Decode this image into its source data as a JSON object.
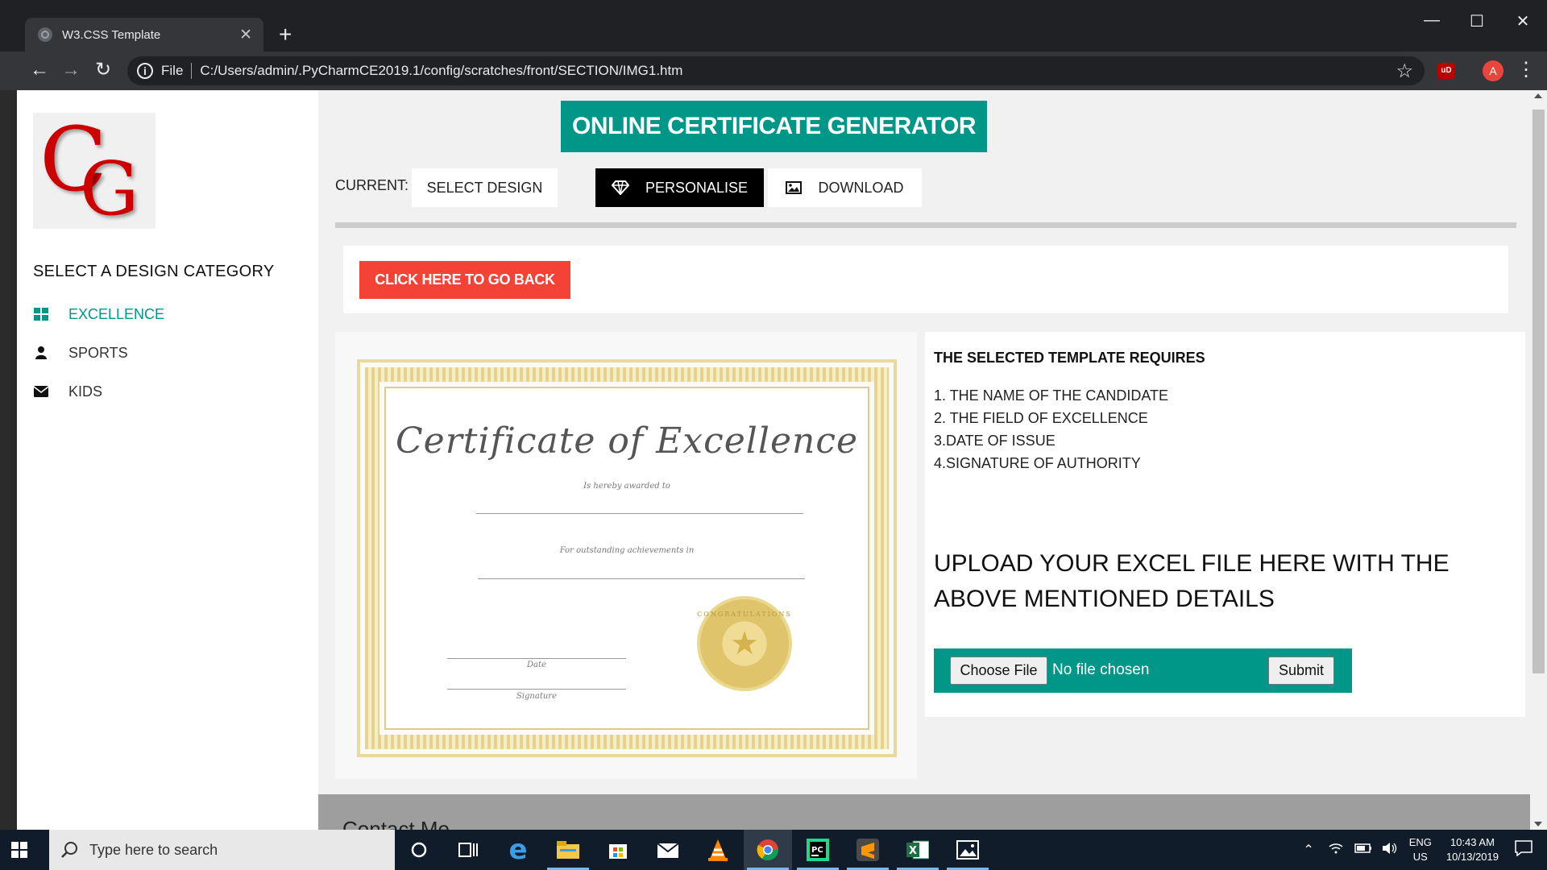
{
  "browser": {
    "tab_title": "W3.CSS Template",
    "scheme_label": "File",
    "url": "C:/Users/admin/.PyCharmCE2019.1/config/scratches/front/SECTION/IMG1.htm",
    "profile_initial": "A",
    "ext_label": "uD"
  },
  "sidebar": {
    "title": "SELECT A DESIGN CATEGORY",
    "items": [
      {
        "label": "EXCELLENCE",
        "icon": "grid-icon"
      },
      {
        "label": "SPORTS",
        "icon": "user-icon"
      },
      {
        "label": "KIDS",
        "icon": "envelope-icon"
      }
    ],
    "logo_text": "CG"
  },
  "header": {
    "title": "ONLINE CERTIFICATE GENERATOR",
    "current_label": "CURRENT:",
    "steps": [
      {
        "label": "SELECT DESIGN"
      },
      {
        "label": "PERSONALISE",
        "icon": "diamond-icon"
      },
      {
        "label": "DOWNLOAD",
        "icon": "image-icon"
      }
    ]
  },
  "back_button": "CLICK HERE TO GO BACK",
  "certificate": {
    "heading": "Certificate of Excellence",
    "awarded": "Is hereby awarded to",
    "achievements": "For outstanding achievements in",
    "date_label": "Date",
    "signature_label": "Signature",
    "seal_text": "CONGRATULATIONS"
  },
  "requirements": {
    "title": "THE SELECTED TEMPLATE REQUIRES",
    "items": [
      "1. THE NAME OF THE CANDIDATE",
      "2. THE FIELD OF EXCELLENCE",
      "3.DATE OF ISSUE",
      "4.SIGNATURE OF AUTHORITY"
    ],
    "upload_text": "UPLOAD YOUR EXCEL FILE HERE WITH THE ABOVE MENTIONED DETAILS",
    "choose_file": "Choose File",
    "no_file": "No file chosen",
    "submit": "Submit"
  },
  "contact": {
    "title": "Contact Me"
  },
  "taskbar": {
    "search_placeholder": "Type here to search",
    "lang": "ENG",
    "region": "US",
    "time": "10:43 AM",
    "date": "10/13/2019"
  },
  "colors": {
    "accent": "#009688",
    "danger": "#f44336",
    "logo": "#cc0000"
  }
}
